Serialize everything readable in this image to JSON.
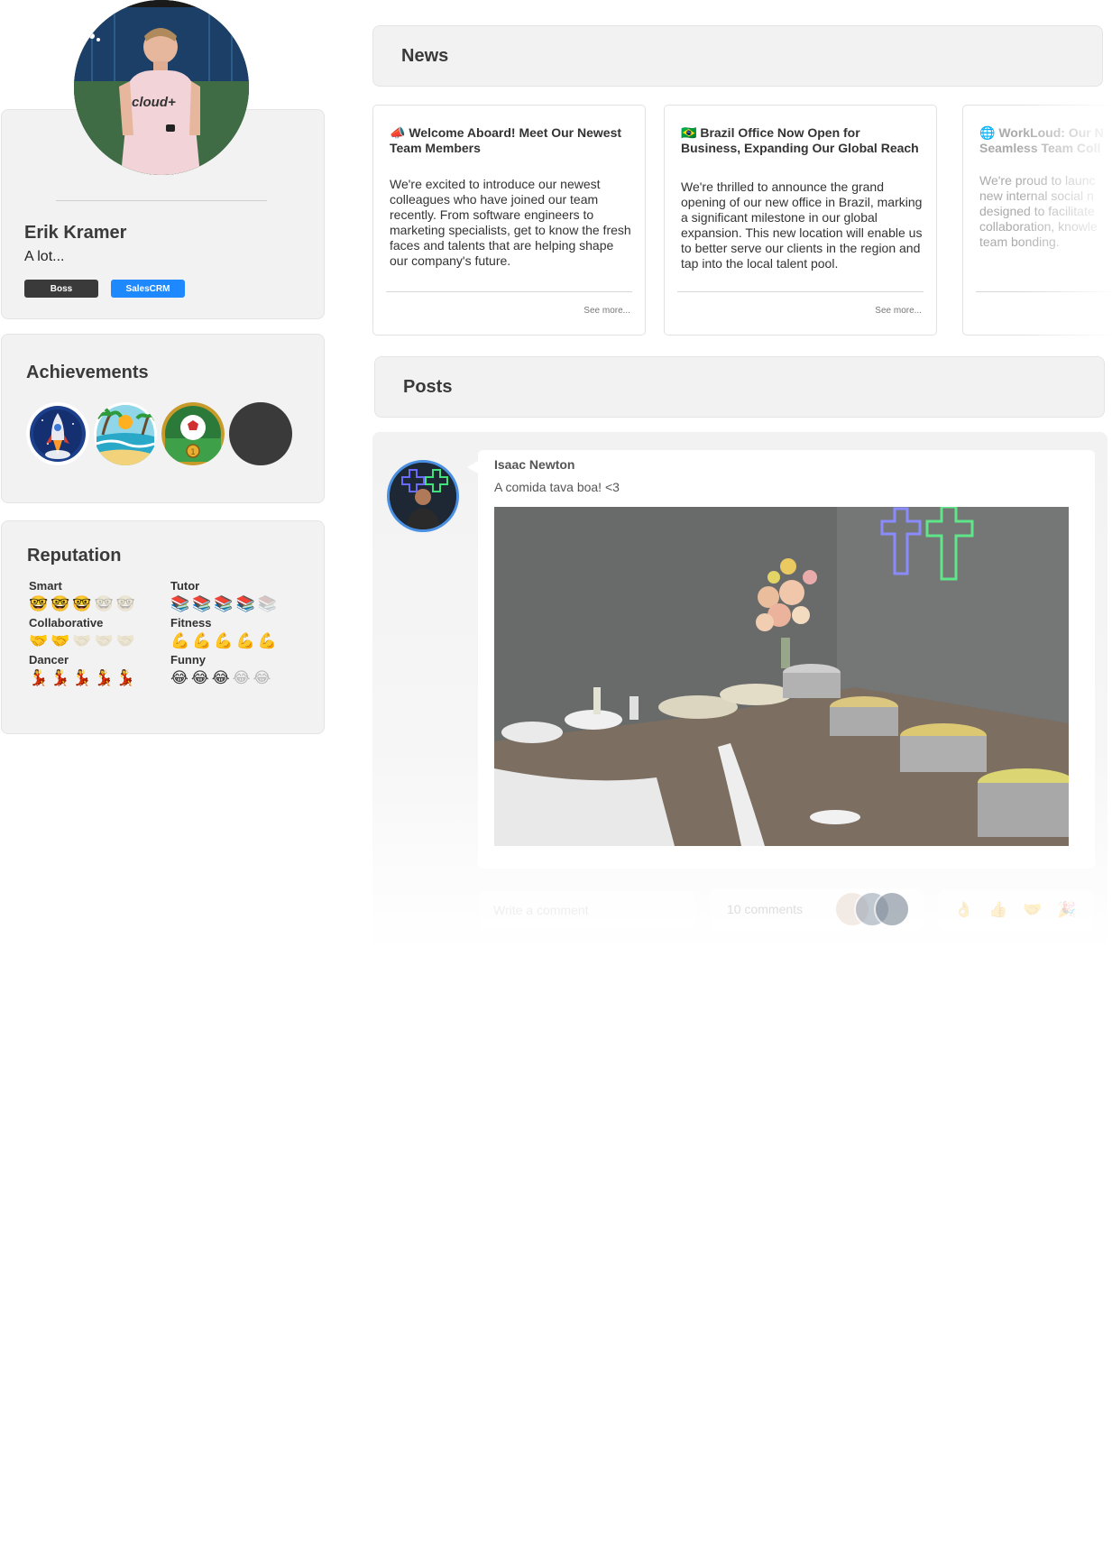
{
  "profile": {
    "name": "Erik Kramer",
    "bio": "A lot...",
    "tags": [
      "Boss",
      "SalesCRM"
    ],
    "shirt_text": "cloud+"
  },
  "achievements": {
    "title": "Achievements",
    "badges": [
      "rocket-badge",
      "beach-badge",
      "soccer-badge",
      "locked-badge"
    ]
  },
  "reputation": {
    "title": "Reputation",
    "items": [
      {
        "label": "Smart",
        "icon": "🤓",
        "level": 3,
        "max": 5
      },
      {
        "label": "Tutor",
        "icon": "📚",
        "level": 4,
        "max": 5
      },
      {
        "label": "Collaborative",
        "icon": "🤝",
        "level": 2,
        "max": 5
      },
      {
        "label": "Fitness",
        "icon": "💪",
        "level": 5,
        "max": 5
      },
      {
        "label": "Dancer",
        "icon": "💃",
        "level": 5,
        "max": 5
      },
      {
        "label": "Funny",
        "icon": "😂",
        "level": 3,
        "max": 5
      }
    ]
  },
  "news": {
    "title": "News",
    "items": [
      {
        "icon": "📣",
        "title": "Welcome Aboard! Meet Our Newest Team Members",
        "body": "We're excited to introduce our newest colleagues who have joined our team recently. From software engineers to marketing specialists, get to know the fresh faces and talents that are helping shape our company's future.",
        "more": "See more..."
      },
      {
        "icon": "🇧🇷",
        "title": "Brazil Office Now Open for Business, Expanding Our Global Reach",
        "body": "We're thrilled to announce the grand opening of our new office in Brazil, marking a significant milestone in our global expansion. This new location will enable us to better serve our clients in the region and tap into the local talent pool.",
        "more": "See more..."
      },
      {
        "icon": "🌐",
        "title_lines": [
          "WorkLoud: Our N",
          "Seamless Team Coll"
        ],
        "body_lines": [
          "We're proud to launc",
          "new internal social n",
          "designed to facilitate",
          "collaboration, knowle",
          "team bonding."
        ]
      }
    ]
  },
  "posts": {
    "title": "Posts",
    "items": [
      {
        "author": "Isaac Newton",
        "text": "A comida tava boa! <3",
        "comment_placeholder": "Write a comment",
        "comments_count": "10 comments",
        "reactions": [
          "👌",
          "👍",
          "🤝",
          "🎉"
        ]
      }
    ]
  }
}
